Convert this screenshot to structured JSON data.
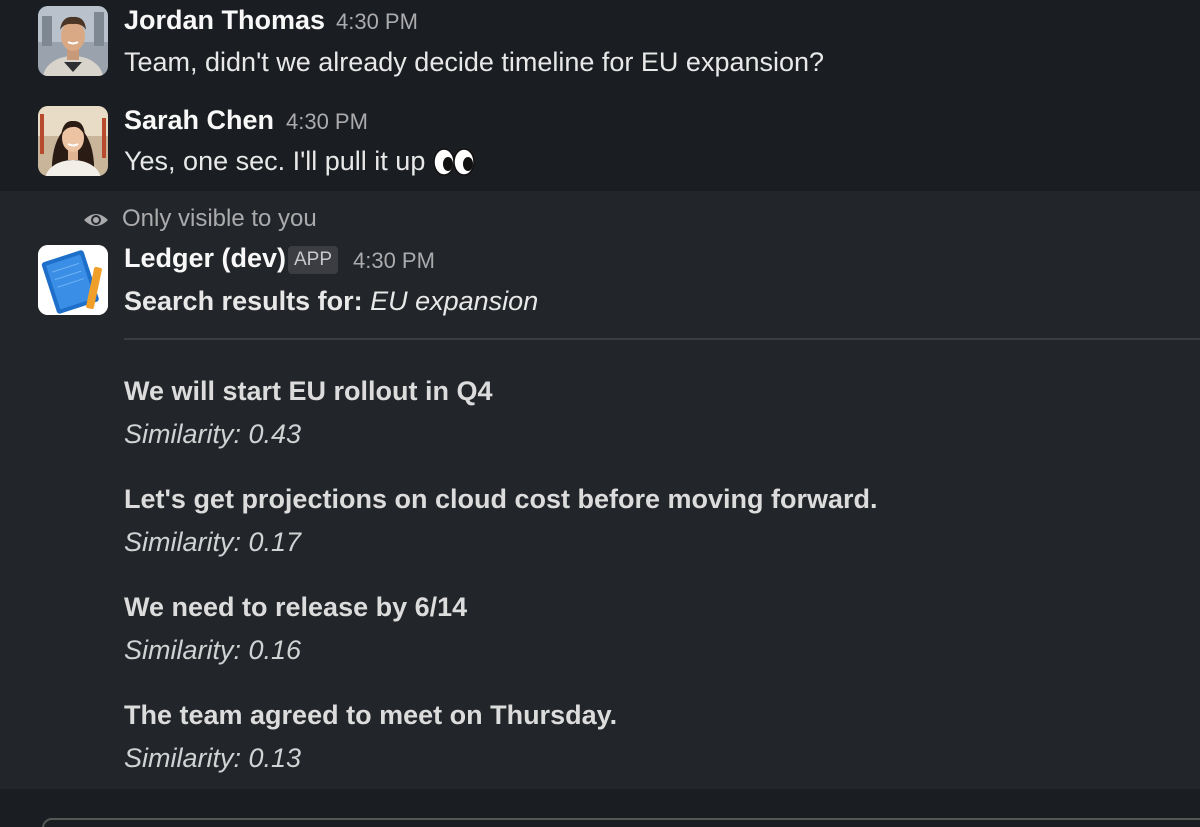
{
  "messages": [
    {
      "author": "Jordan Thomas",
      "time": "4:30 PM",
      "text": "Team, didn't we already decide timeline for EU expansion?"
    },
    {
      "author": "Sarah Chen",
      "time": "4:30 PM",
      "text": "Yes, one sec. I'll pull it up",
      "emoji_icon": "eyes-emoji"
    }
  ],
  "app_message": {
    "visibility_note": "Only visible to you",
    "author": "Ledger (dev)",
    "badge": "APP",
    "time": "4:30 PM",
    "search_prefix": "Search results for:",
    "search_query": "EU expansion",
    "results": [
      {
        "title": "We will start EU rollout in Q4",
        "similarity": "Similarity: 0.43"
      },
      {
        "title": "Let's get projections on cloud cost before moving forward.",
        "similarity": "Similarity: 0.17"
      },
      {
        "title": "We need to release by 6/14",
        "similarity": "Similarity: 0.16"
      },
      {
        "title": "The team agreed to meet on Thursday.",
        "similarity": "Similarity: 0.13"
      }
    ]
  },
  "colors": {
    "background": "#1a1d21",
    "ephemeral_background": "#222529",
    "author_text": "#f8f8f8",
    "timestamp_text": "#ababad"
  }
}
